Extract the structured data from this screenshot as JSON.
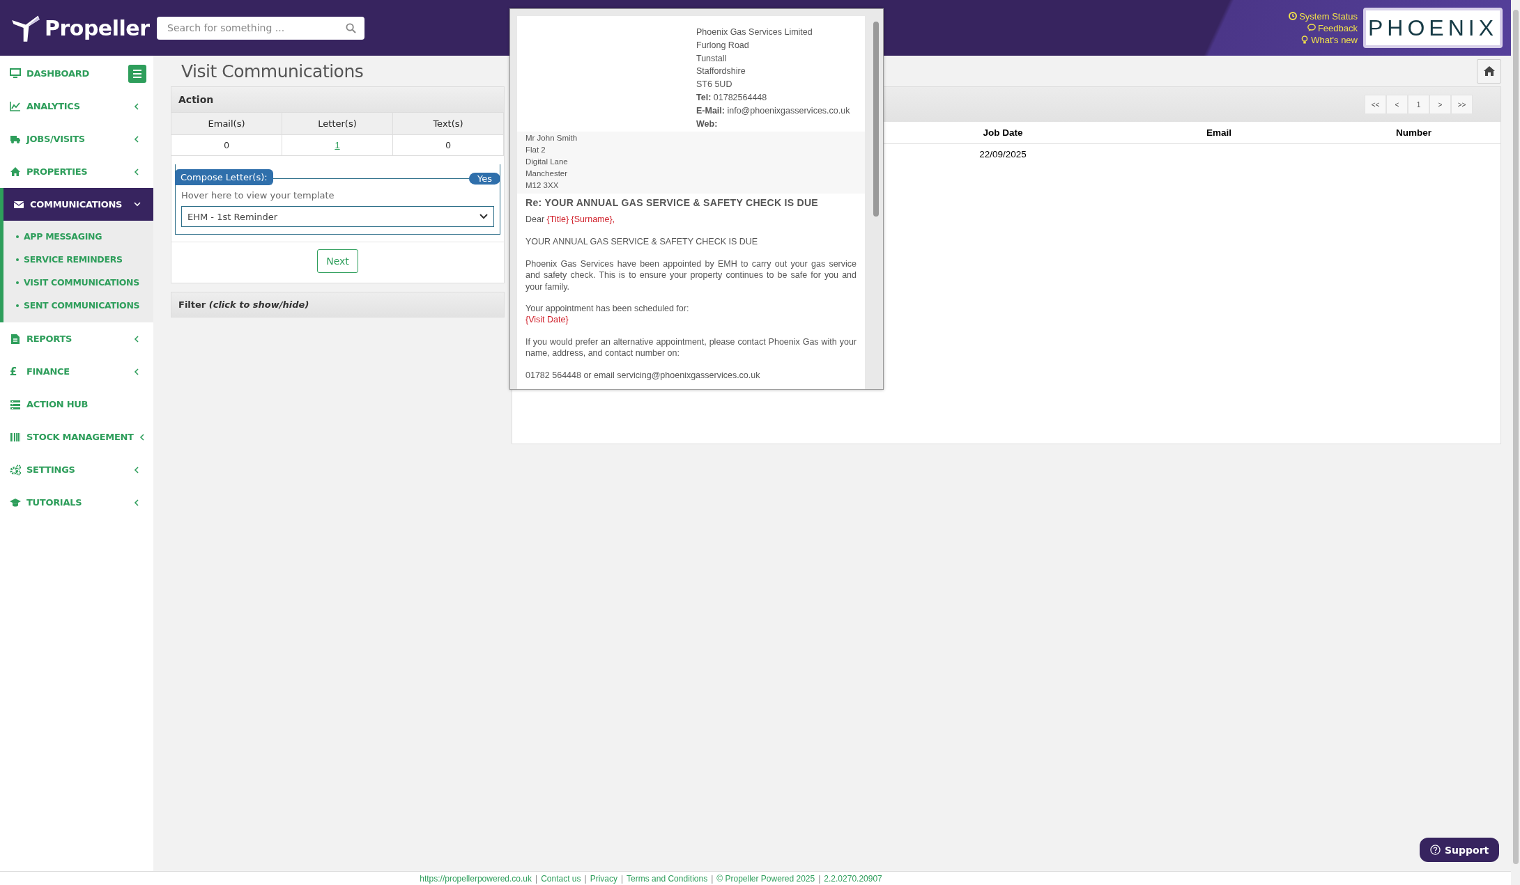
{
  "header": {
    "logo_text": "Propeller",
    "search": {
      "placeholder": "Search for something ..."
    },
    "links": [
      {
        "label": "System Status"
      },
      {
        "label": "Feedback"
      },
      {
        "label": "What's new"
      }
    ],
    "partner_logo": "PHOENIX"
  },
  "sidebar": {
    "items": [
      {
        "label": "DASHBOARD",
        "selected": false
      },
      {
        "label": "ANALYTICS",
        "selected": false,
        "expanded": false
      },
      {
        "label": "JOBS/VISITS",
        "selected": false,
        "expanded": false
      },
      {
        "label": "PROPERTIES",
        "selected": false,
        "expanded": false
      },
      {
        "label": "COMMUNICATIONS",
        "selected": true,
        "expanded": true,
        "children": [
          {
            "label": "APP MESSAGING"
          },
          {
            "label": "SERVICE REMINDERS"
          },
          {
            "label": "VISIT COMMUNICATIONS"
          },
          {
            "label": "SENT COMMUNICATIONS"
          }
        ]
      },
      {
        "label": "REPORTS",
        "selected": false,
        "expanded": false
      },
      {
        "label": "FINANCE",
        "glyph": "£",
        "selected": false,
        "expanded": false
      },
      {
        "label": "ACTION HUB",
        "selected": false
      },
      {
        "label": "STOCK MANAGEMENT",
        "selected": false,
        "expanded": false
      },
      {
        "label": "SETTINGS",
        "selected": false,
        "expanded": false
      },
      {
        "label": "TUTORIALS",
        "selected": false,
        "expanded": false
      }
    ]
  },
  "page": {
    "title": "Visit Communications"
  },
  "action_panel": {
    "heading": "Action",
    "columns": [
      "Email(s)",
      "Letter(s)",
      "Text(s)"
    ],
    "values": [
      {
        "text": "0",
        "kind": "plain"
      },
      {
        "text": "1",
        "kind": "link"
      },
      {
        "text": "0",
        "kind": "plain"
      }
    ],
    "compose": {
      "legend": "Compose Letter(s):",
      "toggle": "Yes",
      "hint": "Hover here to view your template",
      "template": "EHM - 1st Reminder"
    },
    "next_button": "Next"
  },
  "filter": {
    "label": "Filter *(click to show/hide)*"
  },
  "jobs_panel": {
    "pagination": [
      "<<",
      "<",
      "1",
      ">",
      ">>"
    ],
    "columns": [
      "Job Date",
      "Email",
      "Number"
    ],
    "rows": [
      [
        "22/09/2025"
      ]
    ]
  },
  "template_preview": {
    "company": [
      "Phoenix Gas Services Limited",
      "Furlong Road",
      "Tunstall",
      "Staffordshire",
      "ST6 5UD"
    ],
    "contacts": [
      {
        "label": "Tel:",
        "value": "01782564448"
      },
      {
        "label": "E-Mail:",
        "value": "info@phoenixgasservices.co.uk"
      },
      {
        "label": "Web:"
      }
    ],
    "recipient": [
      "Mr John Smith",
      "Flat 2",
      "Digital Lane",
      "Manchester",
      "M12 3XX"
    ],
    "subject": "Re: YOUR ANNUAL GAS SERVICE & SAFETY CHECK IS DUE",
    "paragraphs": [
      [
        {
          "text": "Dear ",
          "kind": "plain"
        },
        {
          "text": "{Title} {Surname},",
          "kind": "field"
        }
      ],
      [
        {
          "text": "YOUR ANNUAL GAS SERVICE & SAFETY CHECK IS DUE",
          "kind": "plain"
        }
      ],
      [
        {
          "text": "Phoenix Gas Services have been appointed by EMH to carry out your gas service and safety check. This is to ensure your property continues to be safe for you and your family.",
          "kind": "plain"
        }
      ],
      [
        {
          "text": "Your appointment has been scheduled for:",
          "kind": "plain"
        }
      ],
      [
        {
          "text": "{Visit Date}",
          "kind": "field"
        }
      ],
      [
        {
          "text": "If you would prefer an alternative appointment, please contact Phoenix Gas with your name, address, and contact number on:",
          "kind": "plain"
        }
      ],
      [
        {
          "text": "01782 564448 or email servicing@phoenixgasservices.co.uk",
          "kind": "plain"
        }
      ]
    ]
  },
  "support_button": "Support",
  "footer": {
    "separator": "|",
    "links": [
      "https://propellerpowered.co.uk",
      "Contact us",
      "Privacy",
      "Terms and Conditions",
      "© Propeller Powered 2025",
      "2.2.0270.20907"
    ]
  }
}
